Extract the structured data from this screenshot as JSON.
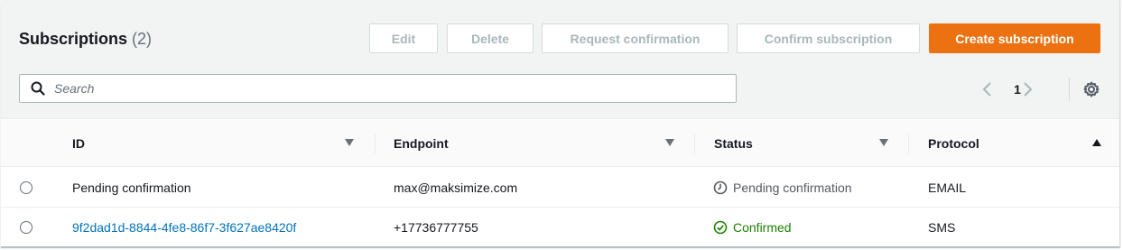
{
  "header": {
    "title": "Subscriptions",
    "count": "(2)"
  },
  "toolbar": {
    "edit_label": "Edit",
    "delete_label": "Delete",
    "request_confirmation_label": "Request confirmation",
    "confirm_subscription_label": "Confirm subscription",
    "create_subscription_label": "Create subscription"
  },
  "search": {
    "placeholder": "Search"
  },
  "pagination": {
    "current_page": "1"
  },
  "table": {
    "columns": [
      "ID",
      "Endpoint",
      "Status",
      "Protocol"
    ],
    "rows": [
      {
        "id": "Pending confirmation",
        "endpoint": "max@maksimize.com",
        "status": "Pending confirmation",
        "protocol": "EMAIL"
      },
      {
        "id": "9f2dad1d-8844-4fe8-86f7-3f627ae8420f",
        "endpoint": "+17736777755",
        "status": "Confirmed",
        "protocol": "SMS"
      }
    ]
  },
  "colors": {
    "primary": "#ec7211",
    "link": "#0073bb",
    "success": "#1d8102",
    "muted": "#687078"
  }
}
